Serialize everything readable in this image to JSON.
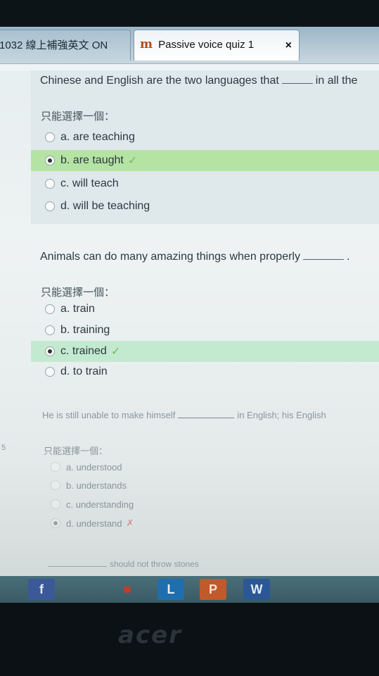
{
  "browser": {
    "tabs": [
      {
        "label": "1032 線上補強英文 ON",
        "active": false
      },
      {
        "label": "Passive voice quiz 1",
        "active": true,
        "icon": "moodle-icon"
      }
    ],
    "close_glyph": "×"
  },
  "quiz": {
    "prompt_label": "只能選擇一個：",
    "questions": [
      {
        "text_before": "Chinese and English are the two languages that",
        "text_after": "in all the",
        "options": [
          {
            "label": "a. are teaching",
            "selected": false
          },
          {
            "label": "b. are taught",
            "selected": true,
            "correct": true
          },
          {
            "label": "c. will teach",
            "selected": false
          },
          {
            "label": "d. will be teaching",
            "selected": false
          }
        ]
      },
      {
        "text_before": "Animals can do many amazing things when properly",
        "text_after": ".",
        "options": [
          {
            "label": "a. train",
            "selected": false
          },
          {
            "label": "b. training",
            "selected": false
          },
          {
            "label": "c. trained",
            "selected": true,
            "correct": true
          },
          {
            "label": "d. to train",
            "selected": false
          }
        ]
      },
      {
        "text_before": "He is still unable to make himself",
        "text_after": "in English; his English",
        "options": [
          {
            "label": "a. understood",
            "selected": false
          },
          {
            "label": "b. understands",
            "selected": false
          },
          {
            "label": "c. understanding",
            "selected": false
          },
          {
            "label": "d. understand",
            "selected": true,
            "correct": false
          }
        ]
      }
    ],
    "next_question_partial": "should not throw stones",
    "side_number": "5"
  },
  "taskbar": {
    "apps": [
      {
        "icon": "facebook-icon",
        "glyph": "f",
        "color": "#3b5998"
      },
      {
        "icon": "piggy-bank-icon",
        "glyph": "●",
        "color": "#c23b2b"
      },
      {
        "icon": "lync-icon",
        "glyph": "L",
        "color": "#1f6fb0"
      },
      {
        "icon": "powerpoint-icon",
        "glyph": "P",
        "color": "#c05a2a"
      },
      {
        "icon": "word-icon",
        "glyph": "W",
        "color": "#2b5797"
      }
    ]
  },
  "device": {
    "brand": "acer"
  }
}
